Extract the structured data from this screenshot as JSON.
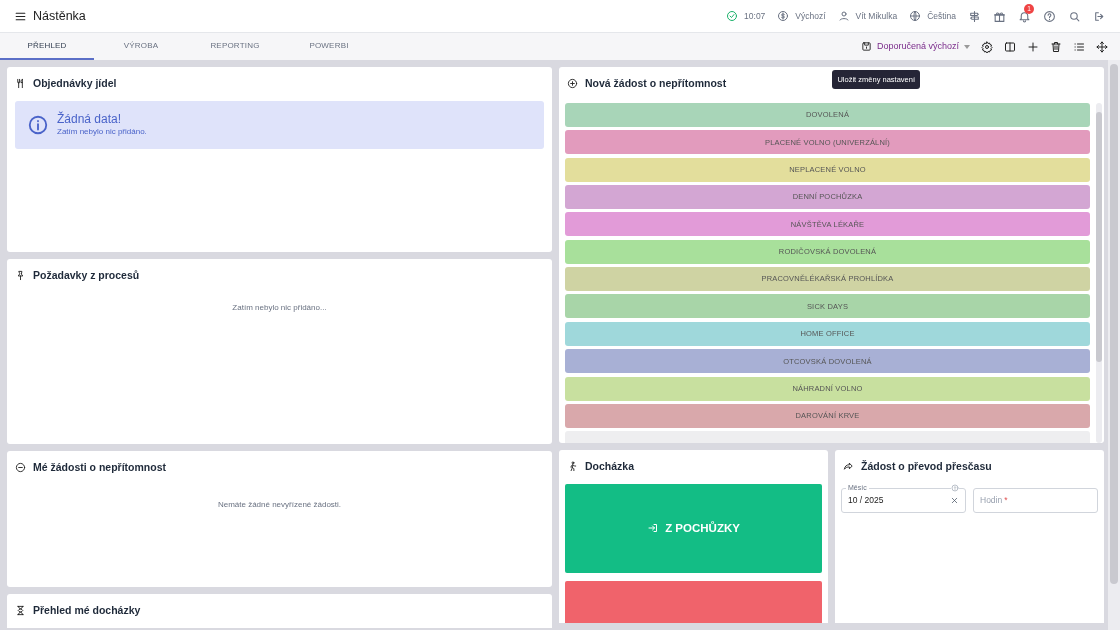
{
  "header": {
    "title": "Nástěnka",
    "clock": "10:07",
    "currency": "Výchozí",
    "user": "Vít Mikulka",
    "language": "Čeština",
    "notifications": "1"
  },
  "tabs": [
    {
      "label": "PŘEHLED",
      "selected": true
    },
    {
      "label": "VÝROBA",
      "selected": false
    },
    {
      "label": "REPORTING",
      "selected": false
    },
    {
      "label": "POWERBI",
      "selected": false
    }
  ],
  "toolbar": {
    "layout": "Doporučená výchozí",
    "tooltip": "Uložit změny nastavení"
  },
  "meal_orders": {
    "title": "Objednávky jídel",
    "alert_title": "Žádná data!",
    "alert_text": "Zatím nebylo nic přidáno."
  },
  "process_requests": {
    "title": "Požadavky z procesů",
    "empty": "Zatím nebylo nic přidáno..."
  },
  "my_requests": {
    "title": "Mé žádosti o nepřítomnost",
    "empty": "Nemáte žádné nevyřízené žádosti."
  },
  "attendance_overview": {
    "title": "Přehled mé docházky"
  },
  "new_absence": {
    "title": "Nová žádost o nepřítomnost",
    "types": [
      {
        "label": "DOVOLENÁ",
        "color": "#a8d5b8"
      },
      {
        "label": "PLACENÉ VOLNO (UNIVERZÁLNÍ)",
        "color": "#e29bbd"
      },
      {
        "label": "NEPLACENÉ VOLNO",
        "color": "#e3de9c"
      },
      {
        "label": "DENNÍ POCHŮZKA",
        "color": "#d3a6d3"
      },
      {
        "label": "NÁVŠTĚVA LÉKAŘE",
        "color": "#e29bd8"
      },
      {
        "label": "RODIČOVSKÁ DOVOLENÁ",
        "color": "#a8e09b"
      },
      {
        "label": "PRACOVNĚLÉKAŘSKÁ PROHLÍDKA",
        "color": "#cfd3a3"
      },
      {
        "label": "SICK DAYS",
        "color": "#a8d5a8"
      },
      {
        "label": "HOME OFFICE",
        "color": "#9fd8db"
      },
      {
        "label": "OTCOVSKÁ DOVOLENÁ",
        "color": "#a8b0d5"
      },
      {
        "label": "NÁHRADNÍ VOLNO",
        "color": "#c8e09f"
      },
      {
        "label": "DAROVÁNÍ KRVE",
        "color": "#d9a8ab"
      },
      {
        "color": "#eeeef0"
      }
    ]
  },
  "attendance": {
    "title": "Docházka",
    "buttons": [
      {
        "label": "Z POCHŮZKY",
        "color": "#13bd85"
      },
      {
        "color": "#f0636b"
      }
    ]
  },
  "overtime": {
    "title": "Žádost o převod přesčasu",
    "month_label": "Měsíc",
    "month_value": "10 / 2025",
    "hours_placeholder": "Hodin",
    "hours_required": "*"
  }
}
